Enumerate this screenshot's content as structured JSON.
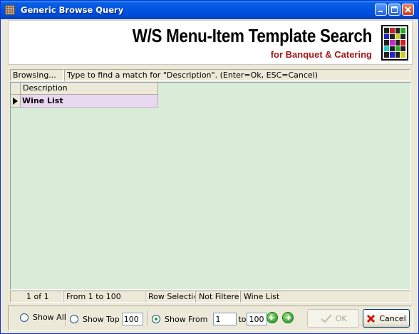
{
  "window": {
    "title": "Generic Browse Query"
  },
  "banner": {
    "title": "W/S Menu-Item Template Search",
    "subtitle": "for Banquet & Catering"
  },
  "browse": {
    "mode": "Browsing...",
    "hint": "Type to find a match for \"Description\". (Enter=Ok, ESC=Cancel)"
  },
  "grid": {
    "columns": [
      "Description"
    ],
    "rows": [
      {
        "description": "Wine List"
      }
    ]
  },
  "status": {
    "record": "1 of 1",
    "range": "From 1 to 100",
    "selection": "Row Selection",
    "filter": "Not Filtered",
    "current": "Wine List"
  },
  "controls": {
    "show_all": "Show All",
    "show_top": "Show Top",
    "show_top_value": "100",
    "show_from": "Show From",
    "from_value": "1",
    "to_label": "to",
    "to_value": "100",
    "selected_option": "Show From",
    "ok_label": "OK",
    "cancel_label": "Cancel"
  },
  "colors": {
    "title_bar": "#0054e3",
    "grid_background": "#d8ecd8",
    "selected_row": "#ead8f2",
    "subtitle": "#a01818"
  }
}
